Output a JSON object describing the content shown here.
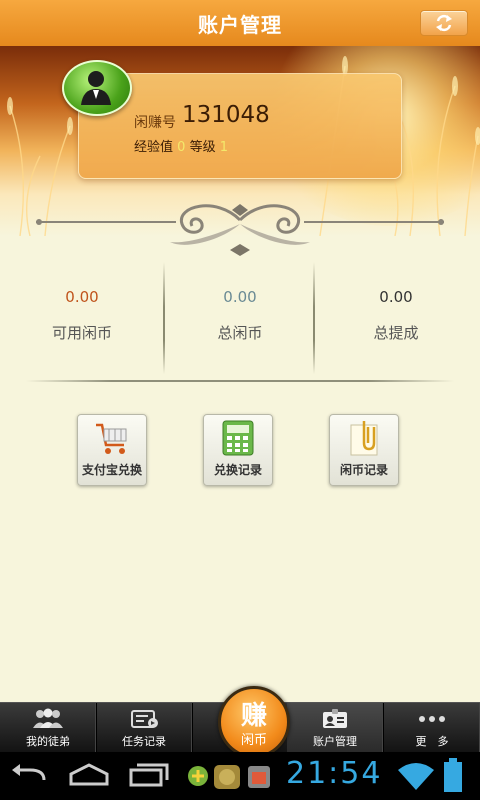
{
  "header": {
    "title": "账户管理"
  },
  "user": {
    "id_label": "闲赚号",
    "id": "131048",
    "exp_label": "经验值",
    "exp": "0",
    "level_label": "等级",
    "level": "1"
  },
  "stats": [
    {
      "value": "0.00",
      "label": "可用闲币",
      "color": "#c0541c"
    },
    {
      "value": "0.00",
      "label": "总闲币",
      "color": "#6a8a94"
    },
    {
      "value": "0.00",
      "label": "总提成",
      "color": "#333333"
    }
  ],
  "actions": [
    {
      "label": "支付宝兑换",
      "icon": "cart-icon"
    },
    {
      "label": "兑换记录",
      "icon": "calculator-icon"
    },
    {
      "label": "闲币记录",
      "icon": "paperclip-note-icon"
    }
  ],
  "tabs": [
    {
      "label": "我的徒弟",
      "icon": "group-icon"
    },
    {
      "label": "任务记录",
      "icon": "task-record-icon"
    },
    {
      "label": "账户管理",
      "icon": "id-card-icon"
    },
    {
      "label": "更　多",
      "icon": "more-dots-icon"
    }
  ],
  "earn": {
    "big": "赚",
    "small": "闲币"
  },
  "system": {
    "clock": "21:54"
  }
}
